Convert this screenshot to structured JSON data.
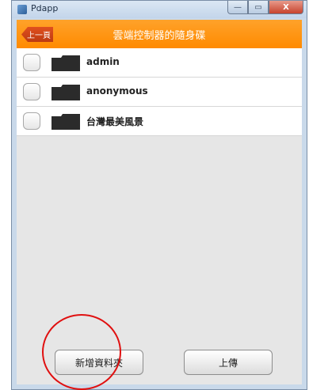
{
  "window": {
    "title": "Pdapp",
    "minimize_label": "—",
    "maximize_label": "▭",
    "close_label": "X"
  },
  "header": {
    "back_label": "上一頁",
    "title": "雲端控制器的隨身碟"
  },
  "folders": [
    {
      "name": "admin"
    },
    {
      "name": "anonymous"
    },
    {
      "name": "台灣最美風景"
    }
  ],
  "actions": {
    "new_folder_label": "新增資料夾",
    "upload_label": "上傳"
  },
  "colors": {
    "header": "#ff8a00",
    "back_button": "#c63f15",
    "highlight": "#e01010"
  }
}
